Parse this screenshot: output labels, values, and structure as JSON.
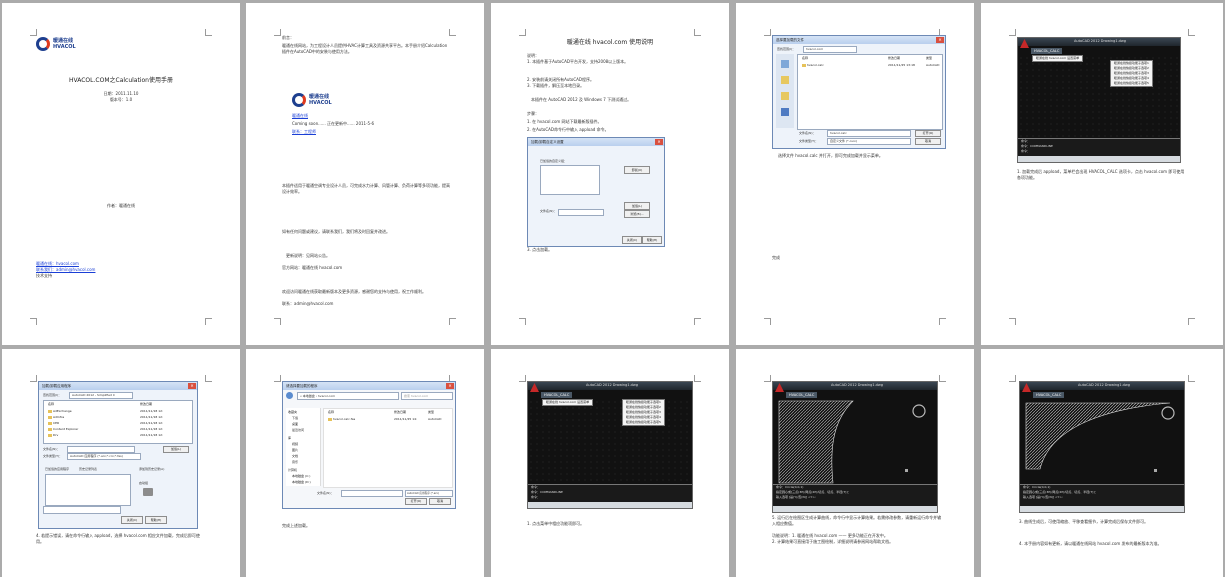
{
  "pages": [
    {
      "brand": {
        "cn": "暖通在线",
        "en": "HVACOL"
      },
      "title": "HVACOL.COM之Calculation使用手册",
      "lines": [
        "日期：2011.11.10",
        "版本号：1.0"
      ],
      "mid": "作者：暖通在线",
      "links": [
        "暖通在线：hvacol.com",
        "联系我们：admin@hvacol.com"
      ],
      "footer": "技术支持"
    },
    {
      "heading": "前言：",
      "para1": "暖通在线网站，为工程设计人员提供HVAC计算工具及资源共享平台。本手册介绍Calculation插件在AutoCAD中的安装与使用方法。",
      "brand": {
        "cn": "暖通在线",
        "en": "HVACOL"
      },
      "site_label": "暖通在线",
      "coming": "Coming soon...... 正在更新中...... 2011-5-6",
      "contact": "联系：工程师",
      "para2": "本插件适用于暖通空调专业设计人员，可完成水力计算、风管计算、负荷计算等多项功能，提高设计效率。",
      "para3": "如有任何问题或建议，请联系我们，我们将及时回复并改进。",
      "note1": "更新说明：见网站公告。",
      "note2": "官方网站：暖通在线 hvacol.com",
      "para4": "欢迎访问暖通在线获取最新版本及更多资源，感谢您的支持与使用，祝工作顺利。",
      "note3": "联系：admin@hvacol.com"
    },
    {
      "heading": "暖通在线 hvacol.com 使用说明",
      "sub": "说明：",
      "items": [
        "1. 本插件基于AutoCAD平台开发，支持2008以上版本。",
        "2. 安装前请关闭所有AutoCAD程序。",
        "3. 下载插件，解压至本地目录。"
      ],
      "os_note": "本插件在 AutoCAD 2012 及 Windows 7 下测试通过。",
      "step_label": "步骤：",
      "step1": "1. 在 hvacol.com 网站下载最新版插件。",
      "step2": "2. 在AutoCAD命令行中输入 appload 命令。",
      "dialog": {
        "title": "加载/卸载自定义设置",
        "group_label": "已加载的自定义组：",
        "btn_unload": "卸载(U)",
        "file_label": "文件名(N)：",
        "btn_browse": "浏览(B)...",
        "btn_load": "加载(L)",
        "btn_ok": "关闭(C)",
        "btn_help": "帮助(H)"
      },
      "caption": "3. 点击加载。"
    },
    {
      "dialog_title": "选择要加载的文件",
      "path_label": "查找范围(I)：",
      "path_value": "hvacol.com",
      "col_name": "名称",
      "col_date": "修改日期",
      "col_type": "类型",
      "file_name": "hvacol.calc",
      "file_date": "2011/11/25 13:18",
      "file_type": "AutoCAD",
      "filename_label": "文件名(N)：",
      "filetype_label": "文件类型(T)：",
      "filename_value": "hvacol.calc",
      "filetype_value": "自定义文件 (*.cuix)",
      "btn_open": "打开(O)",
      "btn_cancel": "取消",
      "caption": "选择文件 hvacol.calc 并打开，即可完成加载并显示菜单。",
      "footer": "完成"
    },
    {
      "cad_title": "AutoCAD 2012   Drawing1.dwg",
      "tab": "HVACOL_CALC",
      "menu_head": "暖通在线 hvacol.com 设置菜单",
      "menu_items": [
        "暖通在线快捷功能子选项1",
        "暖通在线快捷功能子选项2",
        "暖通在线快捷功能子选项3",
        "暖通在线快捷功能子选项4",
        "暖通在线快捷功能子选项5"
      ],
      "cmd_lines": [
        "命令：",
        "命令：COMMANDLINE",
        "命令："
      ],
      "caption": "1. 加载完成后 appload，菜单栏会出现 HVACOL_CALC 选项卡，点击 hvacol.com 即可使用各项功能。"
    },
    {
      "dialog_title": "加载/卸载应用程序",
      "path_label": "查找范围(I)：",
      "path_value": "AutoCAD 2012 - Simplified C",
      "col_name": "名称",
      "col_date": "修改日期",
      "rows": [
        "AdExchange",
        "AdInfos",
        "CER",
        "Content Explorer",
        "Drv"
      ],
      "dates": [
        "2011/11/18 12:",
        "2011/11/18 12:",
        "2011/11/18 12:",
        "2011/11/18 12:",
        "2011/11/18 12:"
      ],
      "filename_label": "文件名(N)：",
      "filetype_label": "文件类型(T)：",
      "filetype_value": "AutoCAD 应用程序 (*.arx;*.crx;*.fas)",
      "btn_load": "加载(L)",
      "loaded_label": "已加载的应用程序",
      "history_label": "历史记录列表",
      "add_label": "添加到历史记录(A)",
      "startup_label": "启动组",
      "btn_close": "关闭(C)",
      "btn_help": "帮助(H)",
      "caption": "4. 若提示错误，请在命令行输入 appload，选择 hvacol.com 相应文件加载，完成后即可使用。"
    },
    {
      "dialog_title": "请选择要加载的程序",
      "crumb": "« 本地磁盘 › hvacol.com",
      "search_placeholder": "搜索 hvacol.com",
      "col_name": "名称",
      "col_date": "修改日期",
      "col_type": "类型",
      "sidebar": [
        "收藏夹",
        "下载",
        "桌面",
        "最近访问",
        "库",
        "视频",
        "图片",
        "文档",
        "音乐",
        "计算机",
        "本地磁盘 (C:)",
        "本地磁盘 (D:)"
      ],
      "file_name": "hvacol.calc.fas",
      "file_date": "2011/11/25 14:",
      "file_type": "AutoCAD",
      "filename_label": "文件名(N)：",
      "filetype_value": "AutoCAD 应用程序 (*.arx)",
      "btn_open": "打开(O)",
      "btn_cancel": "取消",
      "caption": "完成上述加载。"
    },
    {
      "cad_title": "AutoCAD 2012   Drawing1.dwg",
      "tab": "HVACOL_CALC",
      "menu_head": "暖通在线 hvacol.com 设置菜单",
      "menu_items": [
        "暖通在线快捷功能子选项1",
        "暖通在线快捷功能子选项2",
        "暖通在线快捷功能子选项3",
        "暖通在线快捷功能子选项4",
        "暖通在线快捷功能子选项5"
      ],
      "cmd_lines": [
        "命令：",
        "命令：COMMANDLINE",
        "命令："
      ],
      "caption": "1. 点击菜单中相应功能项即可。"
    },
    {
      "cad_title": "AutoCAD 2012   Drawing1.dwg",
      "tab": "HVACOL_CALC",
      "cmd_lines": [
        "命令：Circle(0,0,1)",
        "指定圆心或[三点(3P)/两点(2P)/切点、切点、半径(T)]：",
        "输入选项 [是(Y)/否(N)] <Y>:"
      ],
      "caption": "5. 运行后在绘图区生成计算曲线，命令行中显示计算结果。若需修改参数，请重新运行命令并输入相应数值。",
      "caption2": "功能说明：1. 暖通在线 hvacol.com —— 更多功能正在开发中。",
      "caption3": "2. 计算结果可直接用于施工图绘制，详细说明请参阅网站帮助文档。"
    },
    {
      "cad_title": "AutoCAD 2012   Drawing1.dwg",
      "tab": "HVACOL_CALC",
      "cmd_lines": [
        "命令：Circle(0,0,1)",
        "指定圆心或[三点(3P)/两点(2P)/切点、切点、半径(T)]：",
        "输入选项 [是(Y)/否(N)] <Y>:"
      ],
      "caption": "3. 曲线生成后，可使用缩放、平移查看细节，计算完成后保存文件即可。",
      "caption2": "4. 本手册内容如有更新，请以暖通在线网站 hvacol.com 发布的最新版本为准。"
    }
  ]
}
